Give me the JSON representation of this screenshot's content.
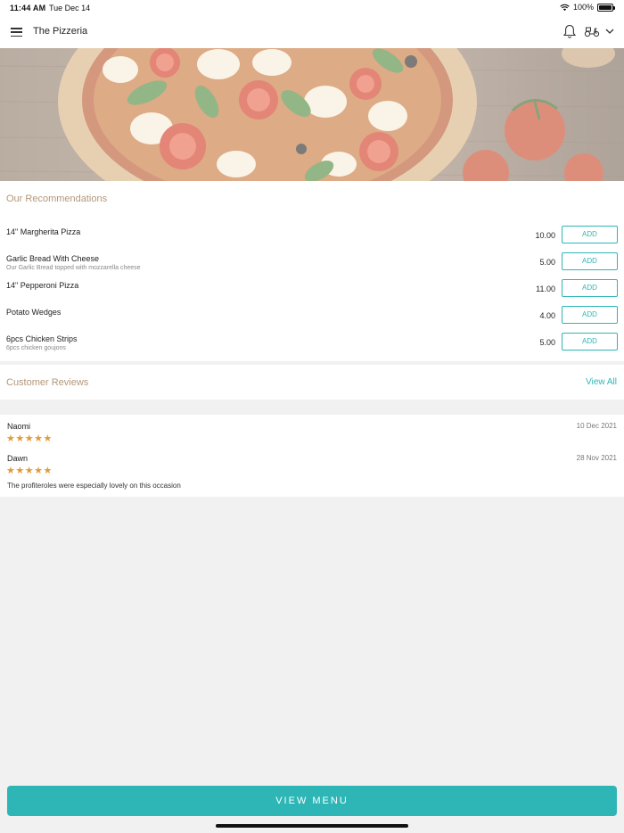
{
  "status_bar": {
    "time": "11:44 AM",
    "date": "Tue Dec 14",
    "battery": "100%",
    "battery_level": 1.0
  },
  "nav": {
    "title": "The Pizzeria",
    "icons": [
      "menu-icon",
      "bell-icon",
      "scooter-icon",
      "chevron-down-icon"
    ]
  },
  "recommendations": {
    "title": "Our Recommendations",
    "items": [
      {
        "name": "14\" Margherita Pizza",
        "description": "",
        "price": "10.00",
        "button": "ADD"
      },
      {
        "name": "Garlic Bread With Cheese",
        "description": "Our Garlic Bread topped with mozzarella cheese",
        "price": "5.00",
        "button": "ADD"
      },
      {
        "name": "14\" Pepperoni Pizza",
        "description": "",
        "price": "11.00",
        "button": "ADD"
      },
      {
        "name": "Potato Wedges",
        "description": "",
        "price": "4.00",
        "button": "ADD"
      },
      {
        "name": "6pcs Chicken Strips",
        "description": "6pcs chicken goujons",
        "price": "5.00",
        "button": "ADD"
      }
    ]
  },
  "reviews": {
    "title": "Customer Reviews",
    "view_all": "View All",
    "items": [
      {
        "name": "Naomi",
        "date": "10 Dec 2021",
        "rating": 5,
        "stars": "★★★★★",
        "text": ""
      },
      {
        "name": "Dawn",
        "date": "28 Nov 2021",
        "rating": 5,
        "stars": "★★★★★",
        "text": "The profiteroles were especially lovely on this occasion"
      }
    ]
  },
  "footer": {
    "view_menu": "VIEW MENU"
  },
  "colors": {
    "accent": "#2eb6b6",
    "section_title": "#b3977a",
    "star": "#e39a36",
    "background": "#f1f1f1"
  }
}
